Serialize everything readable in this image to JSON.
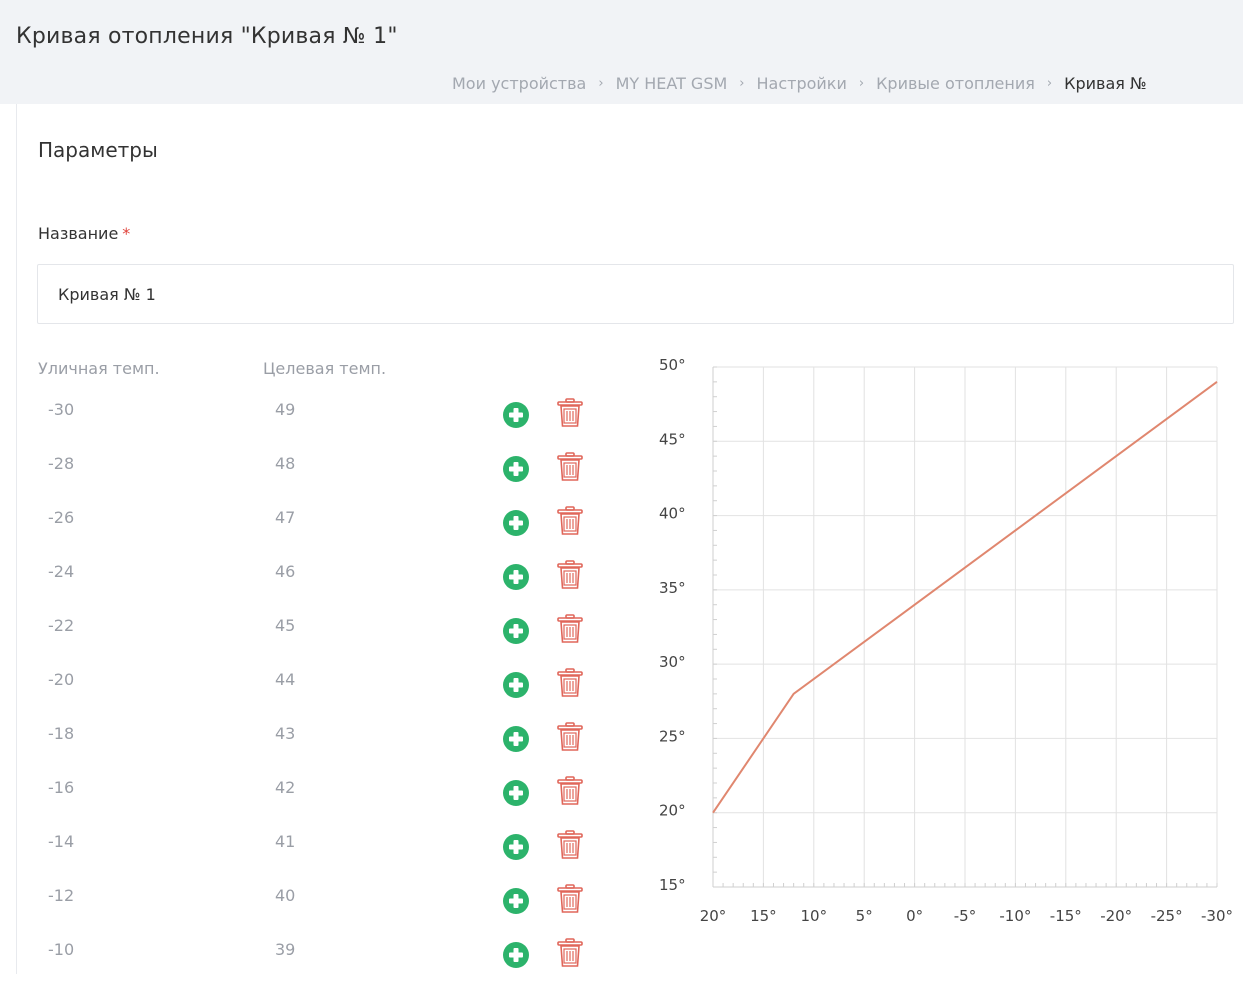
{
  "header": {
    "title": "Кривая отопления \"Кривая № 1\"",
    "breadcrumb": {
      "items": [
        "Мои устройства",
        "MY HEAT GSM",
        "Настройки",
        "Кривые отопления"
      ],
      "current": "Кривая №",
      "separator": "›"
    }
  },
  "section": {
    "title": "Параметры"
  },
  "form": {
    "name_label": "Название",
    "required_mark": "*",
    "name_value": "Кривая № 1"
  },
  "table": {
    "headers": {
      "outdoor": "Уличная темп.",
      "target": "Целевая темп."
    },
    "rows": [
      {
        "outdoor": "-30",
        "target": "49"
      },
      {
        "outdoor": "-28",
        "target": "48"
      },
      {
        "outdoor": "-26",
        "target": "47"
      },
      {
        "outdoor": "-24",
        "target": "46"
      },
      {
        "outdoor": "-22",
        "target": "45"
      },
      {
        "outdoor": "-20",
        "target": "44"
      },
      {
        "outdoor": "-18",
        "target": "43"
      },
      {
        "outdoor": "-16",
        "target": "42"
      },
      {
        "outdoor": "-14",
        "target": "41"
      },
      {
        "outdoor": "-12",
        "target": "40"
      },
      {
        "outdoor": "-10",
        "target": "39"
      }
    ],
    "add_icon": "plus-circle-icon",
    "delete_icon": "trash-icon",
    "add_color": "#2cb36b",
    "delete_color": "#e0665a"
  },
  "chart_data": {
    "type": "line",
    "x_ticks": [
      "20°",
      "15°",
      "10°",
      "5°",
      "0°",
      "-5°",
      "-10°",
      "-15°",
      "-20°",
      "-25°",
      "-30°"
    ],
    "y_ticks": [
      "50°",
      "45°",
      "40°",
      "35°",
      "30°",
      "25°",
      "20°",
      "15°"
    ],
    "xlim": [
      20,
      -30
    ],
    "ylim": [
      15,
      50
    ],
    "series": [
      {
        "x": [
          20,
          12,
          -30
        ],
        "y": [
          20,
          28,
          49
        ]
      }
    ],
    "line_color": "#e0876f",
    "grid": true
  }
}
